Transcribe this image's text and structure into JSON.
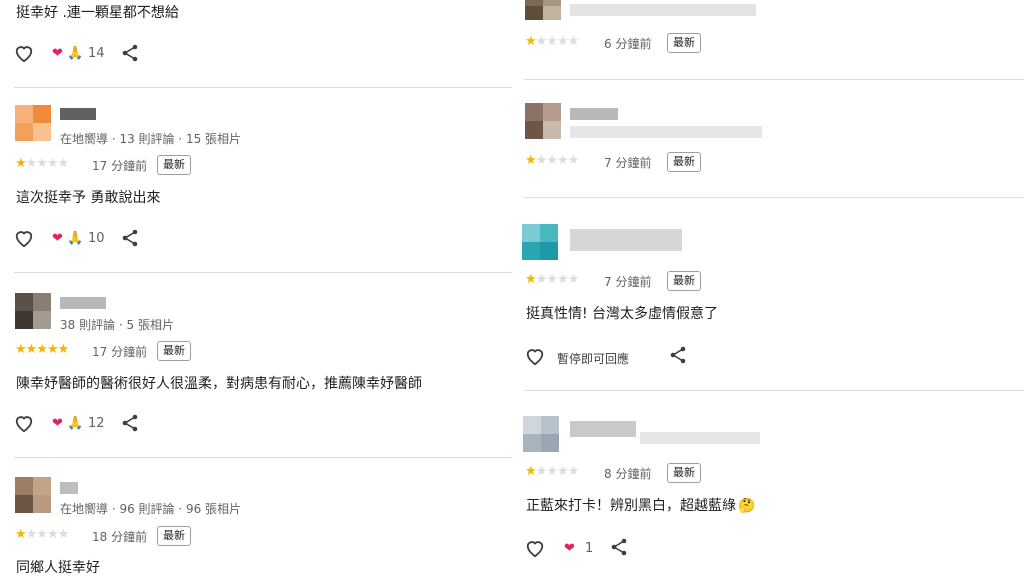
{
  "left": {
    "top_partial": {
      "text": "挺幸好 .連一顆星都不想給",
      "reactions": {
        "count": "14"
      }
    },
    "reviews": [
      {
        "meta": "在地嚮導 · 13 則評論 · 15 張相片",
        "stars": 1,
        "time": "17 分鐘前",
        "badge": "最新",
        "text": "這次挺幸予 勇敢說出來",
        "reactions": {
          "count": "10"
        },
        "avatar_colors": [
          "#f7b17a",
          "#f08b3a",
          "#f8c28e",
          "#f3a05a"
        ]
      },
      {
        "meta": "38 則評論 · 5 張相片",
        "stars": 5,
        "time": "17 分鐘前",
        "badge": "最新",
        "text": "陳幸妤醫師的醫術很好人很溫柔，對病患有耐心，推薦陳幸妤醫師",
        "reactions": {
          "count": "12"
        },
        "avatar_colors": [
          "#5a5048",
          "#8b7d72",
          "#3d3631",
          "#a39a92"
        ]
      },
      {
        "meta": "在地嚮導 · 96 則評論 · 96 張相片",
        "stars": 1,
        "time": "18 分鐘前",
        "badge": "最新",
        "text": "同鄉人挺幸好",
        "avatar_colors": [
          "#9c7c63",
          "#c4a487",
          "#6b5544",
          "#b89a80"
        ]
      }
    ]
  },
  "right": {
    "reviews": [
      {
        "stars": 1,
        "time": "6 分鐘前",
        "badge": "最新",
        "avatar_colors": [
          "#7d6a55",
          "#a69682",
          "#5e4d3d",
          "#c2b39f"
        ]
      },
      {
        "stars": 1,
        "time": "7 分鐘前",
        "badge": "最新",
        "avatar_colors": [
          "#8b7266",
          "#b49c8e",
          "#6e5547",
          "#c9b8ac"
        ]
      },
      {
        "stars": 1,
        "time": "7 分鐘前",
        "badge": "最新",
        "text": "挺真性情! 台灣太多虛情假意了",
        "pause_text": "暫停即可回應",
        "avatar_colors": [
          "#49b6c0",
          "#1d9aa7",
          "#7ccbd2",
          "#2aa6b2"
        ]
      },
      {
        "stars": 1,
        "time": "8 分鐘前",
        "badge": "最新",
        "text": "正藍來打卡！辨別黑白，超越藍綠",
        "emoji": "🤔",
        "reactions": {
          "count": "1"
        },
        "avatar_colors": [
          "#b8c2cc",
          "#9aa6b2",
          "#cfd6dd",
          "#a9b3bd"
        ]
      }
    ]
  },
  "colors": {
    "star": "#f4b400",
    "heart": "#e0245e",
    "divider": "#dadce0"
  },
  "icons": {
    "like": "heart-outline-icon",
    "share": "share-icon",
    "reaction_heart": "heart-emoji-icon",
    "reaction_pray": "pray-emoji-icon"
  }
}
